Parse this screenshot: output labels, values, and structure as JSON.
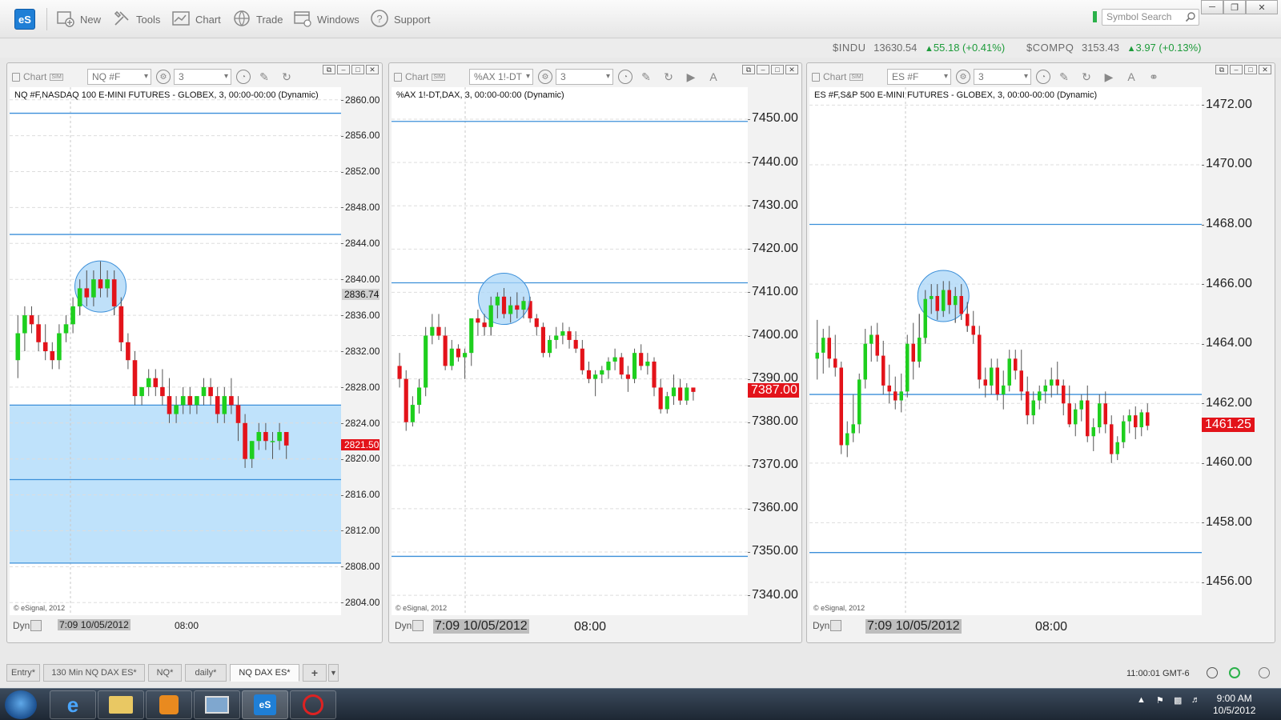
{
  "toolbar": {
    "logo": "eS",
    "buttons": [
      {
        "label": "New",
        "icon": "new-icon"
      },
      {
        "label": "Tools",
        "icon": "tools-icon"
      },
      {
        "label": "Chart",
        "icon": "chart-icon"
      },
      {
        "label": "Trade",
        "icon": "trade-icon"
      },
      {
        "label": "Windows",
        "icon": "windows-icon"
      },
      {
        "label": "Support",
        "icon": "help-icon"
      }
    ],
    "search_placeholder": "Symbol Search"
  },
  "tickers": [
    {
      "symbol": "$INDU",
      "price": "13630.54",
      "change": "55.18 (+0.41%)"
    },
    {
      "symbol": "$COMPQ",
      "price": "3153.43",
      "change": "3.97 (+0.13%)"
    }
  ],
  "panels": [
    {
      "title": "Chart",
      "symbol": "NQ #F",
      "interval": "3",
      "subtitle": "NQ #F,NASDAQ 100 E-MINI FUTURES - GLOBEX, 3, 00:00-00:00 (Dynamic)",
      "copyright": "© eSignal, 2012",
      "dyn": "Dyn",
      "x_start": "7:09 10/05/2012",
      "x_tick": "08:00",
      "y_ticks": [
        "2860.00",
        "2856.00",
        "2852.00",
        "2848.00",
        "2844.00",
        "2840.00",
        "2836.00",
        "2832.00",
        "2828.00",
        "2824.00",
        "2820.00",
        "2816.00",
        "2812.00",
        "2808.00",
        "2804.00"
      ],
      "crosshair_label": "2836.74",
      "last_price": "2821.50"
    },
    {
      "title": "Chart",
      "symbol": "%AX 1!-DT",
      "interval": "3",
      "subtitle": "%AX 1!-DT,DAX, 3, 00:00-00:00 (Dynamic)",
      "copyright": "© eSignal, 2012",
      "dyn": "Dyn",
      "x_start": "7:09 10/05/2012",
      "x_tick": "08:00",
      "y_ticks": [
        "7450.00",
        "7440.00",
        "7430.00",
        "7420.00",
        "7410.00",
        "7400.00",
        "7390.00",
        "7380.00",
        "7370.00",
        "7360.00",
        "7350.00",
        "7340.00"
      ],
      "last_price": "7387.00"
    },
    {
      "title": "Chart",
      "symbol": "ES #F",
      "interval": "3",
      "subtitle": "ES #F,S&P 500 E-MINI FUTURES - GLOBEX, 3, 00:00-00:00 (Dynamic)",
      "copyright": "© eSignal, 2012",
      "dyn": "Dyn",
      "x_start": "7:09 10/05/2012",
      "x_tick": "08:00",
      "y_ticks": [
        "1472.00",
        "1470.00",
        "1468.00",
        "1466.00",
        "1464.00",
        "1462.00",
        "1460.00",
        "1458.00",
        "1456.00"
      ],
      "last_price": "1461.25"
    }
  ],
  "chart_data": [
    {
      "type": "candlestick",
      "symbol": "NQ #F",
      "ylim": [
        2802.6,
        2861.4
      ],
      "hlines": [
        2858.5,
        2845.0,
        2826.0,
        2817.7,
        2808.4
      ],
      "shaded_band": [
        2808.4,
        2826.0
      ],
      "highlight_center": 2839.2,
      "last": 2821.5,
      "candles": [
        [
          2831,
          2836,
          2829,
          2834
        ],
        [
          2834,
          2837,
          2832,
          2836
        ],
        [
          2836,
          2837,
          2834,
          2835
        ],
        [
          2835,
          2836,
          2832,
          2833
        ],
        [
          2833,
          2835,
          2831,
          2832
        ],
        [
          2832,
          2833,
          2830,
          2831
        ],
        [
          2831,
          2835,
          2830,
          2834
        ],
        [
          2834,
          2836,
          2833,
          2835
        ],
        [
          2835,
          2838,
          2834,
          2837
        ],
        [
          2837,
          2840,
          2836,
          2839
        ],
        [
          2839,
          2841,
          2837,
          2838
        ],
        [
          2838,
          2841,
          2837,
          2840
        ],
        [
          2840,
          2842,
          2838,
          2839
        ],
        [
          2839,
          2841,
          2838,
          2840
        ],
        [
          2840,
          2841,
          2836,
          2837
        ],
        [
          2837,
          2838,
          2832,
          2833
        ],
        [
          2833,
          2834,
          2830,
          2831
        ],
        [
          2831,
          2832,
          2826,
          2827
        ],
        [
          2827,
          2828,
          2826,
          2828
        ],
        [
          2828,
          2830,
          2827,
          2829
        ],
        [
          2829,
          2830,
          2827,
          2828
        ],
        [
          2828,
          2830,
          2826,
          2827
        ],
        [
          2827,
          2829,
          2824,
          2825
        ],
        [
          2825,
          2827,
          2824,
          2826
        ],
        [
          2826,
          2828,
          2825,
          2827
        ],
        [
          2827,
          2828,
          2825,
          2826
        ],
        [
          2826,
          2827,
          2825,
          2827
        ],
        [
          2827,
          2829,
          2826,
          2828
        ],
        [
          2828,
          2829,
          2826,
          2827
        ],
        [
          2827,
          2828,
          2824,
          2825
        ],
        [
          2825,
          2828,
          2824,
          2827
        ],
        [
          2827,
          2829,
          2825,
          2826
        ],
        [
          2826,
          2827,
          2822,
          2824
        ],
        [
          2824,
          2825,
          2819,
          2820
        ],
        [
          2820,
          2822,
          2819,
          2822
        ],
        [
          2822,
          2824,
          2821,
          2823
        ],
        [
          2823,
          2824,
          2821,
          2822
        ],
        [
          2822,
          2823,
          2820,
          2822
        ],
        [
          2822,
          2824,
          2821,
          2823
        ],
        [
          2823,
          2823,
          2820,
          2821.5
        ]
      ]
    },
    {
      "type": "candlestick",
      "symbol": "%AX 1!-DT",
      "ylim": [
        7335.4,
        7457.4
      ],
      "hlines": [
        7449.5,
        7412.2,
        7349.0
      ],
      "highlight_center": 7408.5,
      "last": 7387.0,
      "candles": [
        [
          7393,
          7396,
          7388,
          7390
        ],
        [
          7390,
          7392,
          7378,
          7380
        ],
        [
          7380,
          7386,
          7379,
          7384
        ],
        [
          7384,
          7390,
          7382,
          7388
        ],
        [
          7388,
          7402,
          7386,
          7400
        ],
        [
          7400,
          7405,
          7398,
          7402
        ],
        [
          7402,
          7405,
          7399,
          7400
        ],
        [
          7400,
          7402,
          7392,
          7393
        ],
        [
          7393,
          7399,
          7392,
          7397
        ],
        [
          7397,
          7398,
          7394,
          7395
        ],
        [
          7395,
          7397,
          7390,
          7396
        ],
        [
          7396,
          7402,
          7393,
          7404
        ],
        [
          7404,
          7406,
          7400,
          7403
        ],
        [
          7403,
          7405,
          7400,
          7402
        ],
        [
          7402,
          7409,
          7400,
          7407
        ],
        [
          7407,
          7410,
          7404,
          7409
        ],
        [
          7409,
          7411,
          7404,
          7405
        ],
        [
          7405,
          7409,
          7403,
          7407
        ],
        [
          7407,
          7410,
          7404,
          7406
        ],
        [
          7406,
          7409,
          7404,
          7408
        ],
        [
          7408,
          7409,
          7403,
          7404
        ],
        [
          7404,
          7405,
          7400,
          7402
        ],
        [
          7402,
          7403,
          7395,
          7396
        ],
        [
          7396,
          7400,
          7395,
          7399
        ],
        [
          7399,
          7402,
          7397,
          7400
        ],
        [
          7400,
          7403,
          7398,
          7401
        ],
        [
          7401,
          7402,
          7397,
          7399
        ],
        [
          7399,
          7401,
          7396,
          7397
        ],
        [
          7397,
          7399,
          7391,
          7392
        ],
        [
          7392,
          7394,
          7389,
          7390
        ],
        [
          7390,
          7392,
          7386,
          7391
        ],
        [
          7391,
          7393,
          7389,
          7392
        ],
        [
          7392,
          7395,
          7390,
          7394
        ],
        [
          7394,
          7397,
          7392,
          7395
        ],
        [
          7395,
          7396,
          7390,
          7391
        ],
        [
          7391,
          7393,
          7387,
          7390
        ],
        [
          7390,
          7397,
          7389,
          7396
        ],
        [
          7396,
          7398,
          7392,
          7393
        ],
        [
          7393,
          7396,
          7391,
          7394
        ],
        [
          7394,
          7395,
          7386,
          7388
        ],
        [
          7388,
          7390,
          7382,
          7383
        ],
        [
          7383,
          7387,
          7382,
          7386
        ],
        [
          7386,
          7391,
          7384,
          7388
        ],
        [
          7388,
          7390,
          7384,
          7385
        ],
        [
          7385,
          7389,
          7384,
          7388
        ],
        [
          7388,
          7388,
          7385,
          7387
        ]
      ]
    },
    {
      "type": "candlestick",
      "symbol": "ES #F",
      "ylim": [
        1454.9,
        1472.6
      ],
      "hlines": [
        1468.0,
        1462.3,
        1457.0
      ],
      "highlight_center": 1465.6,
      "last": 1461.25,
      "candles": [
        [
          1463.5,
          1464.8,
          1462.8,
          1463.7
        ],
        [
          1463.7,
          1464.5,
          1463.0,
          1464.2
        ],
        [
          1464.2,
          1464.6,
          1463.2,
          1463.5
        ],
        [
          1463.5,
          1464.3,
          1462.9,
          1463.2
        ],
        [
          1463.2,
          1463.4,
          1460.3,
          1460.6
        ],
        [
          1460.6,
          1461.4,
          1460.2,
          1461.0
        ],
        [
          1461.0,
          1462.3,
          1460.7,
          1461.3
        ],
        [
          1461.3,
          1463.0,
          1461.0,
          1462.8
        ],
        [
          1462.8,
          1464.5,
          1462.5,
          1464.0
        ],
        [
          1464.0,
          1464.6,
          1463.4,
          1464.3
        ],
        [
          1464.3,
          1464.7,
          1463.4,
          1463.6
        ],
        [
          1463.6,
          1464.1,
          1462.3,
          1462.6
        ],
        [
          1462.6,
          1463.3,
          1462.0,
          1462.4
        ],
        [
          1462.4,
          1462.9,
          1461.8,
          1462.1
        ],
        [
          1462.1,
          1463.0,
          1461.7,
          1462.4
        ],
        [
          1462.4,
          1464.3,
          1462.2,
          1464.0
        ],
        [
          1464.0,
          1464.7,
          1462.8,
          1463.4
        ],
        [
          1463.4,
          1465.0,
          1463.2,
          1464.2
        ],
        [
          1464.2,
          1465.8,
          1464.0,
          1465.5
        ],
        [
          1465.5,
          1466.0,
          1465.0,
          1465.6
        ],
        [
          1465.6,
          1466.0,
          1464.8,
          1465.1
        ],
        [
          1465.1,
          1466.1,
          1464.9,
          1465.8
        ],
        [
          1465.8,
          1466.1,
          1465.0,
          1465.3
        ],
        [
          1465.3,
          1465.9,
          1464.7,
          1465.6
        ],
        [
          1465.6,
          1466.0,
          1464.8,
          1465.0
        ],
        [
          1465.0,
          1465.4,
          1464.4,
          1464.6
        ],
        [
          1464.6,
          1465.1,
          1464.0,
          1464.3
        ],
        [
          1464.3,
          1464.6,
          1462.5,
          1462.8
        ],
        [
          1462.8,
          1463.2,
          1462.2,
          1462.6
        ],
        [
          1462.6,
          1463.5,
          1462.3,
          1463.2
        ],
        [
          1463.2,
          1463.5,
          1462.1,
          1462.3
        ],
        [
          1462.3,
          1463.1,
          1461.8,
          1462.6
        ],
        [
          1462.6,
          1463.8,
          1462.4,
          1463.5
        ],
        [
          1463.5,
          1463.8,
          1462.8,
          1463.1
        ],
        [
          1463.1,
          1463.8,
          1462.1,
          1462.4
        ],
        [
          1462.4,
          1462.9,
          1461.3,
          1461.6
        ],
        [
          1461.6,
          1462.4,
          1461.3,
          1462.1
        ],
        [
          1462.1,
          1462.6,
          1461.8,
          1462.4
        ],
        [
          1462.4,
          1462.8,
          1462.0,
          1462.6
        ],
        [
          1462.6,
          1463.2,
          1462.2,
          1462.8
        ],
        [
          1462.8,
          1463.4,
          1462.3,
          1462.6
        ],
        [
          1462.6,
          1462.8,
          1461.6,
          1462.0
        ],
        [
          1462.0,
          1462.6,
          1461.2,
          1461.3
        ],
        [
          1461.3,
          1462.0,
          1460.9,
          1461.8
        ],
        [
          1461.8,
          1462.3,
          1461.4,
          1462.1
        ],
        [
          1462.1,
          1462.6,
          1460.7,
          1460.9
        ],
        [
          1460.9,
          1461.5,
          1460.4,
          1461.2
        ],
        [
          1461.2,
          1462.3,
          1461.0,
          1462.0
        ],
        [
          1462.0,
          1462.4,
          1461.0,
          1461.3
        ],
        [
          1461.3,
          1461.6,
          1460.0,
          1460.3
        ],
        [
          1460.3,
          1460.9,
          1460.1,
          1460.7
        ],
        [
          1460.7,
          1461.6,
          1460.5,
          1461.4
        ],
        [
          1461.4,
          1461.8,
          1461.0,
          1461.6
        ],
        [
          1461.6,
          1461.9,
          1460.8,
          1461.2
        ],
        [
          1461.2,
          1461.8,
          1460.9,
          1461.7
        ],
        [
          1461.7,
          1462.0,
          1461.1,
          1461.25
        ]
      ]
    }
  ],
  "tabs": [
    "Entry*",
    "130 Min NQ DAX ES*",
    "NQ*",
    "daily*",
    "NQ DAX ES*"
  ],
  "status": {
    "clock": "11:00:01 GMT-6"
  },
  "taskbar": {
    "time": "9:00 AM",
    "date": "10/5/2012"
  },
  "colors": {
    "up": "#1ecf1e",
    "down": "#e3131a",
    "line": "#3b8fd9",
    "band": "#bfe2fb",
    "price_tag": "#e3131a",
    "highlight": "#a9d6f7"
  }
}
